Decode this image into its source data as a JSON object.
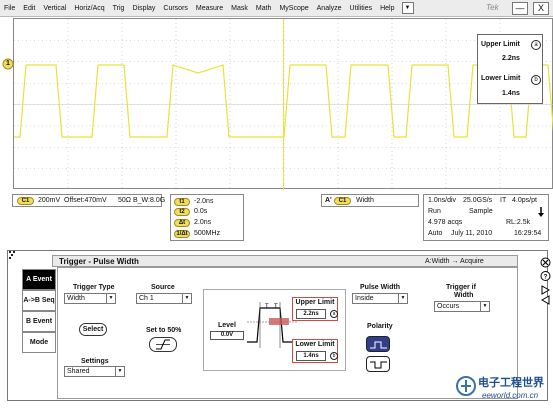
{
  "menu": {
    "items": [
      "File",
      "Edit",
      "Vertical",
      "Horiz/Acq",
      "Trig",
      "Display",
      "Cursors",
      "Measure",
      "Mask",
      "Math",
      "MyScope",
      "Analyze",
      "Utilities",
      "Help"
    ],
    "dropdown_glyph": "▼",
    "window_title": "Tek",
    "minimize_glyph": "—",
    "close_glyph": "X"
  },
  "scope": {
    "channel_marker": "1",
    "trace_color": "#e8e23a",
    "grid_color": "#bbbbbb"
  },
  "limits": {
    "upper_label": "Upper Limit",
    "upper_badge": "a",
    "upper_value": "2.2ns",
    "lower_label": "Lower Limit",
    "lower_badge": "b",
    "lower_value": "1.4ns"
  },
  "readouts": {
    "ch_badge": "C1",
    "vscale": "200mV",
    "offset": "Offset:470mV",
    "impedance": "50Ω",
    "bw": "B_W:8.0G",
    "cursors": [
      {
        "badge": "t1",
        "value": "-2.0ns"
      },
      {
        "badge": "t2",
        "value": "0.0s"
      },
      {
        "badge": "Δt",
        "value": "2.0ns"
      },
      {
        "badge": "1/Δt",
        "value": "500MHz"
      }
    ],
    "trigger_badge_a": "A'",
    "trigger_badge_c": "C1",
    "trigger_mode": "Width",
    "timebase": "1.0ns/div",
    "sample_rate": "25.0GS/s",
    "it": "IT",
    "pts": "4.0ps/pt",
    "run": "Run",
    "sample": "Sample",
    "acqs": "4.978 acqs",
    "rl": "RL:2.5k",
    "auto": "Auto",
    "date": "July 11, 2010",
    "time": "16:29:54"
  },
  "trigger_panel": {
    "title": "Trigger - Pulse Width",
    "right_text": "A:Width → Acquire",
    "tabs": [
      "A Event",
      "A->B Seq",
      "B Event",
      "Mode"
    ],
    "trigger_type_label": "Trigger Type",
    "trigger_type_value": "Width",
    "select_button": "Select",
    "settings_label": "Settings",
    "settings_value": "Shared",
    "source_label": "Source",
    "source_value": "Ch 1",
    "set50_label": "Set to 50%",
    "level_label": "Level",
    "level_value": "0.0V",
    "upper_limit_label": "Upper Limit",
    "upper_limit_value": "2.2ns",
    "upper_badge": "a",
    "lower_limit_label": "Lower Limit",
    "lower_limit_value": "1.4ns",
    "lower_badge": "b",
    "pulse_width_label": "Pulse Width",
    "pulse_width_value": "Inside",
    "polarity_label": "Polarity",
    "trigger_if_label1": "Trigger if",
    "trigger_if_label2": "Width",
    "trigger_if_value": "Occurs"
  },
  "watermark": {
    "line1": "电子工程世界",
    "line2": "eeworld.com.cn"
  }
}
